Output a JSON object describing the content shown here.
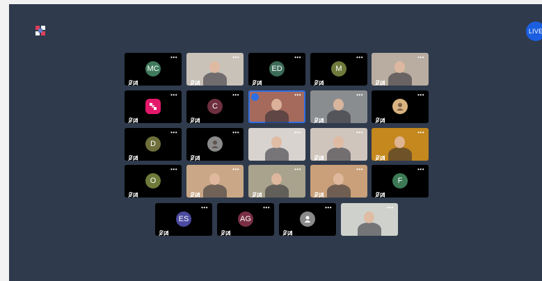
{
  "live_badge": "LIVE",
  "more_glyph": "•••",
  "colors": {
    "stage_bg": "#2f3a4c",
    "tile_bg": "#000000",
    "live_bg": "#1b5fe0",
    "speaking_border": "#2f6fe6"
  },
  "participants": [
    {
      "initials": "MC",
      "type": "avatar",
      "color": "#3f7a5c",
      "muted": true
    },
    {
      "initials": "",
      "type": "video",
      "bg": "#c9c2b8",
      "muted": true
    },
    {
      "initials": "ED",
      "type": "avatar",
      "color": "#3c6b58",
      "muted": true
    },
    {
      "initials": "M",
      "type": "avatar",
      "color": "#6e7a3c",
      "muted": true
    },
    {
      "initials": "",
      "type": "video",
      "bg": "#b9aca0",
      "muted": true
    },
    {
      "initials": "",
      "type": "app-icon",
      "color": "#e4186a",
      "muted": true
    },
    {
      "initials": "C",
      "type": "avatar",
      "color": "#6e2f3f",
      "muted": true
    },
    {
      "initials": "",
      "type": "video",
      "bg": "#a56a5c",
      "muted": false,
      "speaking": true
    },
    {
      "initials": "",
      "type": "video",
      "bg": "#8a8d8f",
      "muted": true
    },
    {
      "initials": "",
      "type": "photo",
      "color": "#d9b380",
      "muted": true
    },
    {
      "initials": "D",
      "type": "avatar",
      "color": "#6e6f3a",
      "muted": true
    },
    {
      "initials": "",
      "type": "photo",
      "color": "#8a8a8a",
      "muted": true
    },
    {
      "initials": "",
      "type": "video",
      "bg": "#d8d3cf",
      "muted": false
    },
    {
      "initials": "",
      "type": "video",
      "bg": "#cfc5bc",
      "muted": true
    },
    {
      "initials": "",
      "type": "video",
      "bg": "#c4881e",
      "muted": true
    },
    {
      "initials": "O",
      "type": "avatar",
      "color": "#6e7a3a",
      "muted": true
    },
    {
      "initials": "",
      "type": "video",
      "bg": "#caa887",
      "muted": true
    },
    {
      "initials": "",
      "type": "video",
      "bg": "#a9a28c",
      "muted": true
    },
    {
      "initials": "",
      "type": "video",
      "bg": "#c9a07a",
      "muted": true
    },
    {
      "initials": "F",
      "type": "avatar",
      "color": "#3c7a56",
      "muted": true
    },
    {
      "initials": "ES",
      "type": "avatar",
      "color": "#4a4aa0",
      "muted": true
    },
    {
      "initials": "AG",
      "type": "avatar",
      "color": "#7a2f45",
      "muted": true
    },
    {
      "initials": "",
      "type": "default-avatar",
      "color": "#8a8a8a",
      "muted": true
    },
    {
      "initials": "",
      "type": "video",
      "bg": "#cfd2cc",
      "muted": false
    }
  ]
}
